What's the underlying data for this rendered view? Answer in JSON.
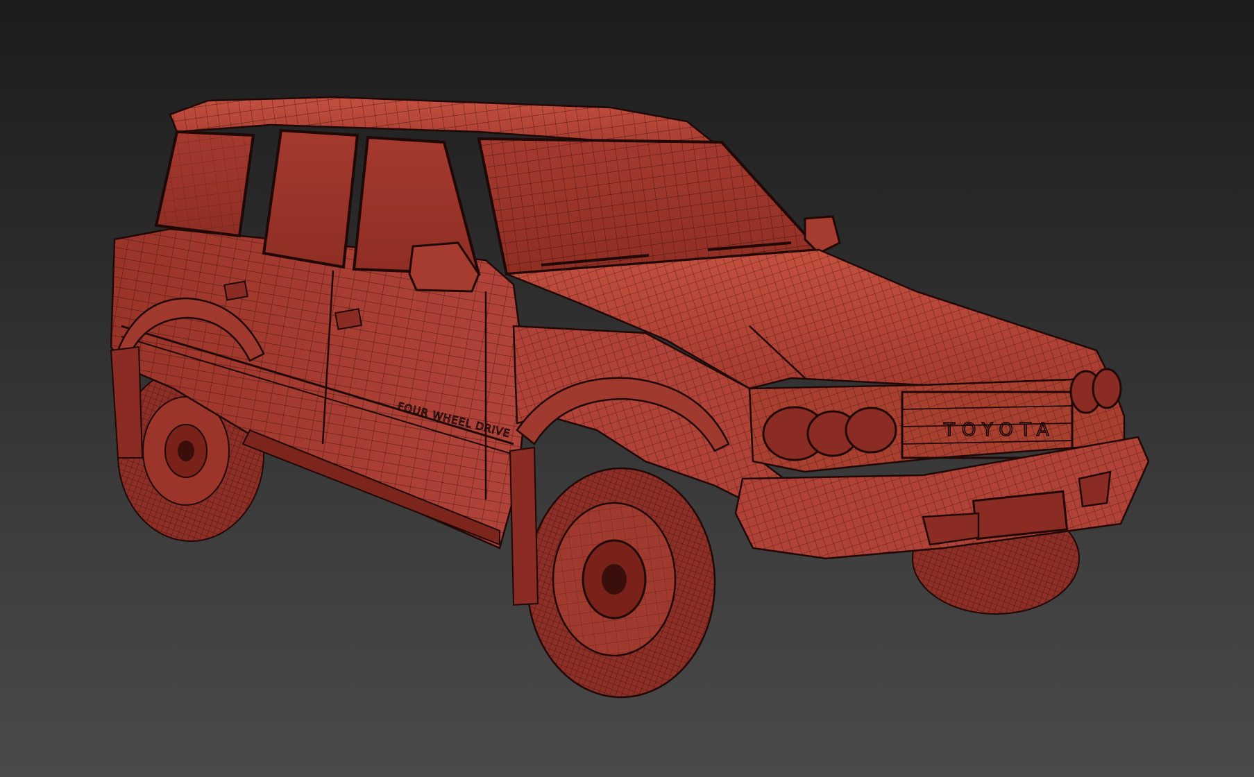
{
  "viewport": {
    "background_top": "#1c1c1c",
    "background_bottom": "#4a4a4a"
  },
  "model": {
    "body_color": "#b8473c",
    "body_dark": "#8e2f27",
    "wire_color": "#2a0b08",
    "grille_text": "TOYOTA",
    "side_decal": "FOUR WHEEL DRIVE"
  }
}
